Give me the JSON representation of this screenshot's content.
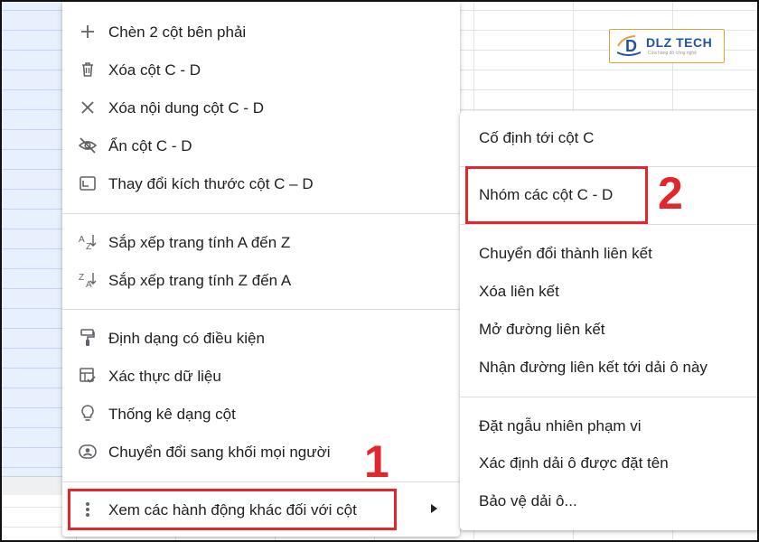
{
  "main_menu": {
    "items": [
      {
        "label": "Chèn 2 cột bên phải",
        "icon": "plus-icon"
      },
      {
        "label": "Xóa cột C - D",
        "icon": "trash-icon"
      },
      {
        "label": "Xóa nội dung cột C - D",
        "icon": "close-icon"
      },
      {
        "label": "Ẩn cột C - D",
        "icon": "eye-off-icon"
      },
      {
        "label": "Thay đổi kích thước cột C – D",
        "icon": "resize-icon"
      },
      {
        "label": "Sắp xếp trang tính A đến Z",
        "icon": "sort-az-icon"
      },
      {
        "label": "Sắp xếp trang tính Z đến A",
        "icon": "sort-za-icon"
      },
      {
        "label": "Định dạng có điều kiện",
        "icon": "paint-roller-icon"
      },
      {
        "label": "Xác thực dữ liệu",
        "icon": "data-validation-icon"
      },
      {
        "label": "Thống kê dạng cột",
        "icon": "lightbulb-icon"
      },
      {
        "label": "Chuyển đổi sang khối mọi người",
        "icon": "people-chip-icon"
      },
      {
        "label": "Xem các hành động khác đối với cột",
        "icon": "more-vertical-icon"
      }
    ]
  },
  "sub_menu": {
    "items": [
      {
        "label": "Cố định tới cột C"
      },
      {
        "label": "Nhóm các cột C - D"
      },
      {
        "label": "Chuyển đổi thành liên kết"
      },
      {
        "label": "Xóa liên kết"
      },
      {
        "label": "Mở đường liên kết"
      },
      {
        "label": "Nhận đường liên kết tới dải ô này"
      },
      {
        "label": "Đặt ngẫu nhiên phạm vi"
      },
      {
        "label": "Xác định dải ô được đặt tên"
      },
      {
        "label": "Bảo vệ dải ô..."
      }
    ]
  },
  "annotations": {
    "step1": "1",
    "step2": "2",
    "color": "#e3262b"
  },
  "logo": {
    "brand": "DLZ TECH",
    "letter": "D",
    "tagline": "Cửa hàng đồ công nghệ"
  }
}
